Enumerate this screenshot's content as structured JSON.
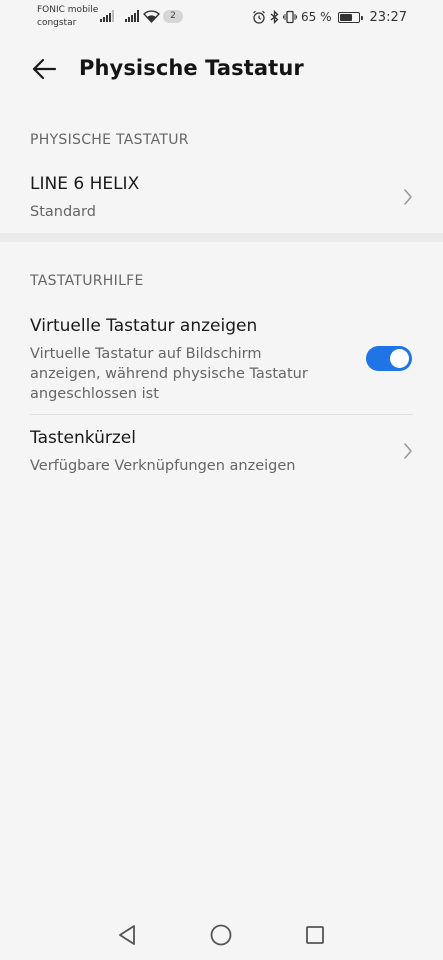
{
  "status_bar": {
    "carrier_line1": "FONIC mobile",
    "carrier_line2": "congstar",
    "notification_count": "2",
    "battery_percent": "65 %",
    "time": "23:27"
  },
  "app_bar": {
    "title": "Physische Tastatur"
  },
  "section_physical": {
    "header": "PHYSISCHE TASTATUR",
    "device_name": "LINE 6 HELIX",
    "device_layout": "Standard"
  },
  "section_help": {
    "header": "TASTATURHILFE",
    "virtual_keyboard_title": "Virtuelle Tastatur anzeigen",
    "virtual_keyboard_desc_line1": "Virtuelle Tastatur auf Bildschirm",
    "virtual_keyboard_desc_line2": "anzeigen, während physische Tastatur",
    "virtual_keyboard_desc_line3": "angeschlossen ist",
    "virtual_keyboard_enabled": true,
    "shortcuts_title": "Tastenkürzel",
    "shortcuts_desc": "Verfügbare Verknüpfungen anzeigen"
  },
  "colors": {
    "accent": "#1f75e6",
    "background": "#f5f5f5"
  }
}
